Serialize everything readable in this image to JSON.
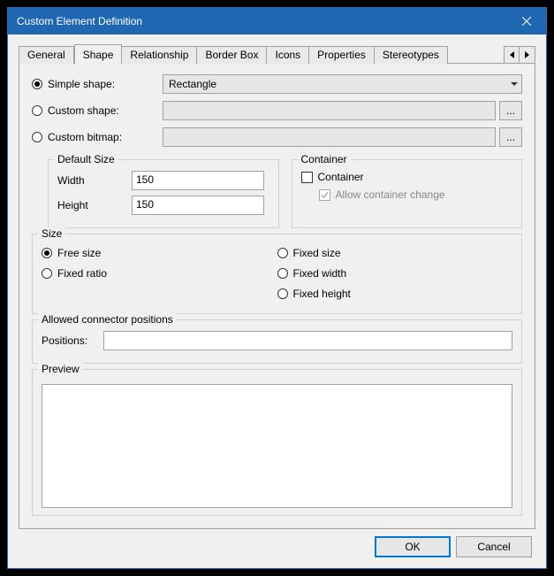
{
  "window": {
    "title": "Custom Element Definition"
  },
  "tabs": {
    "items": [
      "General",
      "Shape",
      "Relationship",
      "Border Box",
      "Icons",
      "Properties",
      "Stereotypes"
    ],
    "active": "Shape"
  },
  "shape": {
    "simple_label": "Simple shape:",
    "simple_value": "Rectangle",
    "custom_shape_label": "Custom shape:",
    "custom_shape_value": "",
    "custom_bitmap_label": "Custom bitmap:",
    "custom_bitmap_value": "",
    "browse": "...",
    "selected": "simple"
  },
  "default_size": {
    "legend": "Default Size",
    "width_label": "Width",
    "width_value": "150",
    "height_label": "Height",
    "height_value": "150"
  },
  "container_grp": {
    "legend": "Container",
    "container_label": "Container",
    "container_checked": false,
    "allow_label": "Allow container change",
    "allow_checked": true
  },
  "size_grp": {
    "legend": "Size",
    "free": "Free size",
    "fixed_ratio": "Fixed ratio",
    "fixed_size": "Fixed size",
    "fixed_width": "Fixed width",
    "fixed_height": "Fixed height",
    "selected": "free"
  },
  "connectors": {
    "legend": "Allowed connector positions",
    "positions_label": "Positions:",
    "positions_value": ""
  },
  "preview": {
    "legend": "Preview"
  },
  "footer": {
    "ok": "OK",
    "cancel": "Cancel"
  }
}
